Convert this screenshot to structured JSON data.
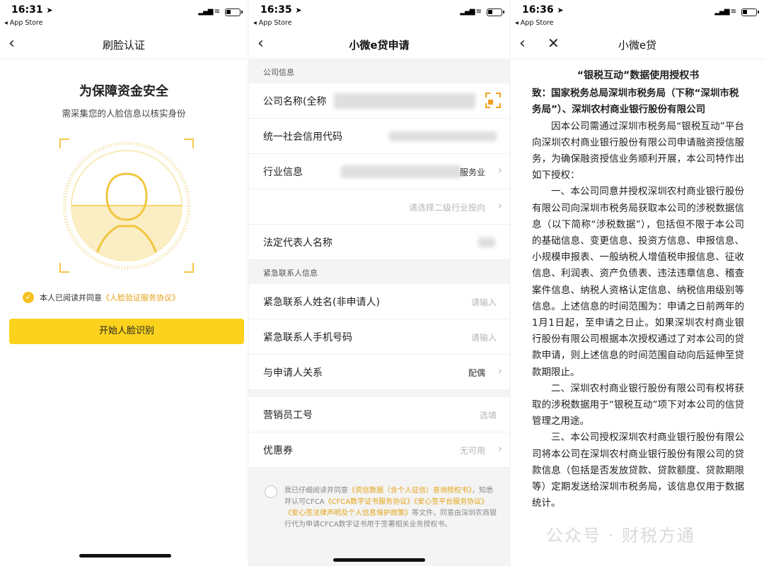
{
  "phone1": {
    "status": {
      "time": "16:31",
      "back_app": "◂ App Store"
    },
    "nav": {
      "title": "刷脸认证"
    },
    "title": "为保障资金安全",
    "subtitle": "需采集您的人脸信息以核实身份",
    "agreement": {
      "prefix": "本人已阅读并同意",
      "link": "《人脸验证服务协议》"
    },
    "button": "开始人脸识别",
    "colors": {
      "accent": "#fcd21c",
      "link": "#e4a317"
    }
  },
  "phone2": {
    "status": {
      "time": "16:35",
      "back_app": "◂ App Store"
    },
    "nav": {
      "title": "小微e贷申请"
    },
    "sections": {
      "company": "公司信息",
      "emergency": "紧急联系人信息"
    },
    "rows": {
      "company_name": {
        "label": "公司名称(全称",
        "value": ""
      },
      "credit_code": {
        "label": "统一社会信用代码"
      },
      "industry": {
        "label": "行业信息",
        "value": "服务业"
      },
      "industry_sub": {
        "placeholder": "请选择二级行业投向"
      },
      "legal_rep": {
        "label": "法定代表人名称"
      },
      "contact_name": {
        "label": "紧急联系人姓名(非申请人)",
        "placeholder": "请输入"
      },
      "contact_phone": {
        "label": "紧急联系人手机号码",
        "placeholder": "请输入"
      },
      "relation": {
        "label": "与申请人关系",
        "value": "配偶"
      },
      "salesman": {
        "label": "营销员工号",
        "placeholder": "选填"
      },
      "coupon": {
        "label": "优惠券",
        "value": "无可用"
      }
    },
    "consent": {
      "t1": "我已仔细阅读并同意",
      "l1": "《资信数据（含个人征信）查询授权书》",
      "t2": "，知悉并认可CFCA",
      "l2": "《CFCA数字证书服务协议》《安心签平台服务协议》《安心签法律声明及个人信息保护政策》",
      "t3": "等文件，同意由深圳农商银行代为申请CFCA数字证书用于签署相关业务授权书。"
    }
  },
  "phone3": {
    "status": {
      "time": "16:36",
      "back_app": "◂ App Store"
    },
    "nav": {
      "title": "小微e贷"
    },
    "doc": {
      "title": "“银税互动”数据使用授权书",
      "to": "致：国家税务总局深圳市税务局（下称“深圳市税务局”）、深圳农村商业银行股份有限公司",
      "p1": "因本公司需通过深圳市税务局“银税互动”平台向深圳农村商业银行股份有限公司申请融资授信服务，为确保融资授信业务顺利开展，本公司特作出如下授权：",
      "p2": "一、本公司同意并授权深圳农村商业银行股份有限公司向深圳市税务局获取本公司的涉税数据信息（以下简称“涉税数据”），包括但不限于本公司的基础信息、变更信息、投资方信息、申报信息、小规模申报表、一般纳税人增值税申报信息、征收信息、利润表、资产负债表、违法违章信息、稽查案件信息、纳税人资格认定信息、纳税信用级别等信息。上述信息的时间范围为：申请之日前两年的1月1日起，至申请之日止。如果深圳农村商业银行股份有限公司根据本次授权通过了对本公司的贷款申请，则上述信息的时间范围自动向后延伸至贷款期限止。",
      "p3": "二、深圳农村商业银行股份有限公司有权将获取的涉税数据用于“银税互动”项下对本公司的信贷管理之用途。",
      "p4": "三、本公司授权深圳农村商业银行股份有限公司将本公司在深圳农村商业银行股份有限公司的贷款信息（包括是否发放贷款、贷款额度、贷款期限等）定期发送给深圳市税务局，该信息仅用于数据统计。"
    },
    "watermark": "公众号 · 财税方通"
  }
}
